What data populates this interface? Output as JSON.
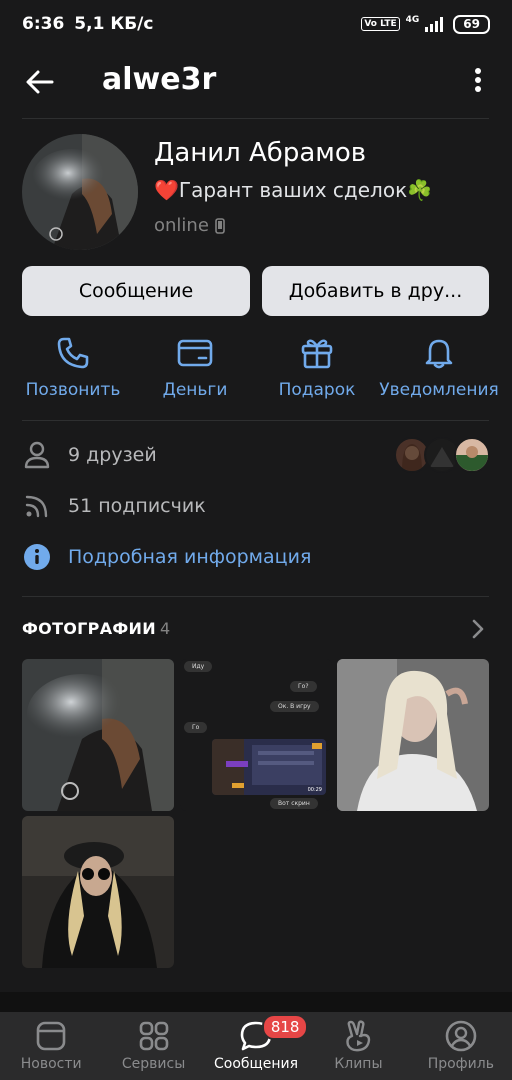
{
  "status_bar": {
    "time": "6:36",
    "speed": "5,1 КБ/с",
    "volte": "Vo LTE",
    "network": "4G",
    "battery": "69"
  },
  "header": {
    "username": "alwe3r"
  },
  "profile": {
    "name": "Данил Абрамов",
    "status": "❤️Гарант ваших сделок☘️",
    "online": "online"
  },
  "buttons": {
    "message": "Сообщение",
    "add_friend": "Добавить в дру..."
  },
  "actions": [
    {
      "label": "Позвонить",
      "icon": "phone-icon"
    },
    {
      "label": "Деньги",
      "icon": "money-icon"
    },
    {
      "label": "Подарок",
      "icon": "gift-icon"
    },
    {
      "label": "Уведомления",
      "icon": "bell-icon"
    }
  ],
  "info": {
    "friends": "9 друзей",
    "followers": "51 подписчик",
    "details": "Подробная информация"
  },
  "photos": {
    "title": "ФОТОГРАФИИ",
    "count": "4",
    "chat": {
      "m1": "Иду",
      "m2": "Го?",
      "m3": "Ок. В игру",
      "m4": "Го",
      "m5": "Вот скрин",
      "time": "00:29"
    }
  },
  "tabbar": {
    "tabs": [
      {
        "label": "Новости",
        "icon": "news-icon"
      },
      {
        "label": "Сервисы",
        "icon": "services-icon"
      },
      {
        "label": "Сообщения",
        "icon": "messages-icon",
        "badge": "818"
      },
      {
        "label": "Клипы",
        "icon": "clips-icon"
      },
      {
        "label": "Профиль",
        "icon": "profile-icon"
      }
    ]
  },
  "colors": {
    "background": "#19191a",
    "accent": "#71aaeb",
    "button": "#e3e4e8",
    "badge": "#e64646"
  }
}
